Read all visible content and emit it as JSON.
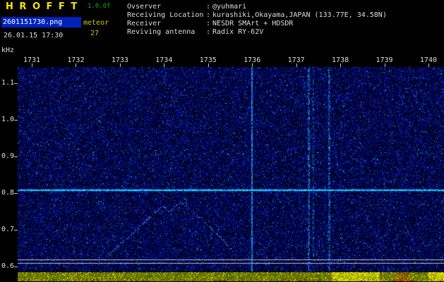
{
  "app": {
    "title": "H R O F F T",
    "version": "1.0.0f",
    "filename": "2601151730.png",
    "meteor_label": "meteor",
    "meteor_count": "27",
    "datetime": "26.01.15 17:30"
  },
  "info_separator": ":",
  "info": [
    {
      "label": "Ovserver",
      "value": "@yuhmari"
    },
    {
      "label": "Receiving Location",
      "value": "kurashiki,Okayama,JAPAN (133.77E, 34.58N)"
    },
    {
      "label": "Receiver",
      "value": "NESDR SMArt + HDSDR"
    },
    {
      "label": "Reviving antenna",
      "value": "Radix RY-62V"
    }
  ],
  "spectrogram": {
    "y_unit": "kHz",
    "x_ticks": [
      "1731",
      "1732",
      "1733",
      "1734",
      "1735",
      "1736",
      "1737",
      "1738",
      "1739",
      "1740"
    ],
    "y_ticks": [
      "1.1",
      "1.0",
      "0.9",
      "0.8",
      "0.7",
      "0.6"
    ],
    "y_range_khz": [
      0.6,
      1.1
    ],
    "features": {
      "carrier_khz": 0.81,
      "white_line_khz": [
        0.62,
        0.61
      ],
      "vertical_lines": [
        {
          "minute": 1736.0,
          "strength": 0.85,
          "width": 2
        },
        {
          "minute": 1737.28,
          "strength": 0.4,
          "width": 3
        },
        {
          "minute": 1737.39,
          "strength": 0.28,
          "width": 2
        },
        {
          "minute": 1737.74,
          "strength": 0.38,
          "width": 3
        }
      ],
      "meteor_trace": [
        [
          1732.71,
          0.629
        ],
        [
          1733.32,
          0.692
        ],
        [
          1733.72,
          0.74
        ],
        [
          1734.0,
          0.765
        ],
        [
          1734.12,
          0.748
        ],
        [
          1734.25,
          0.765
        ],
        [
          1734.38,
          0.772
        ],
        [
          1734.54,
          0.763
        ],
        [
          1734.92,
          0.721
        ],
        [
          1735.28,
          0.679
        ],
        [
          1735.58,
          0.64
        ]
      ],
      "strip_bright_minutes": [
        [
          1737.8,
          1738.9
        ],
        [
          1740.0,
          1740.45
        ]
      ],
      "strip_red_minutes": [
        [
          1739.2,
          1739.6
        ]
      ]
    },
    "colors": {
      "noise_blue": "#0022cc",
      "carrier_cyan": "#00e0ff",
      "white_line": "#c8c8c8",
      "strip_yellow": "#b8b800",
      "background": "#000000"
    }
  }
}
